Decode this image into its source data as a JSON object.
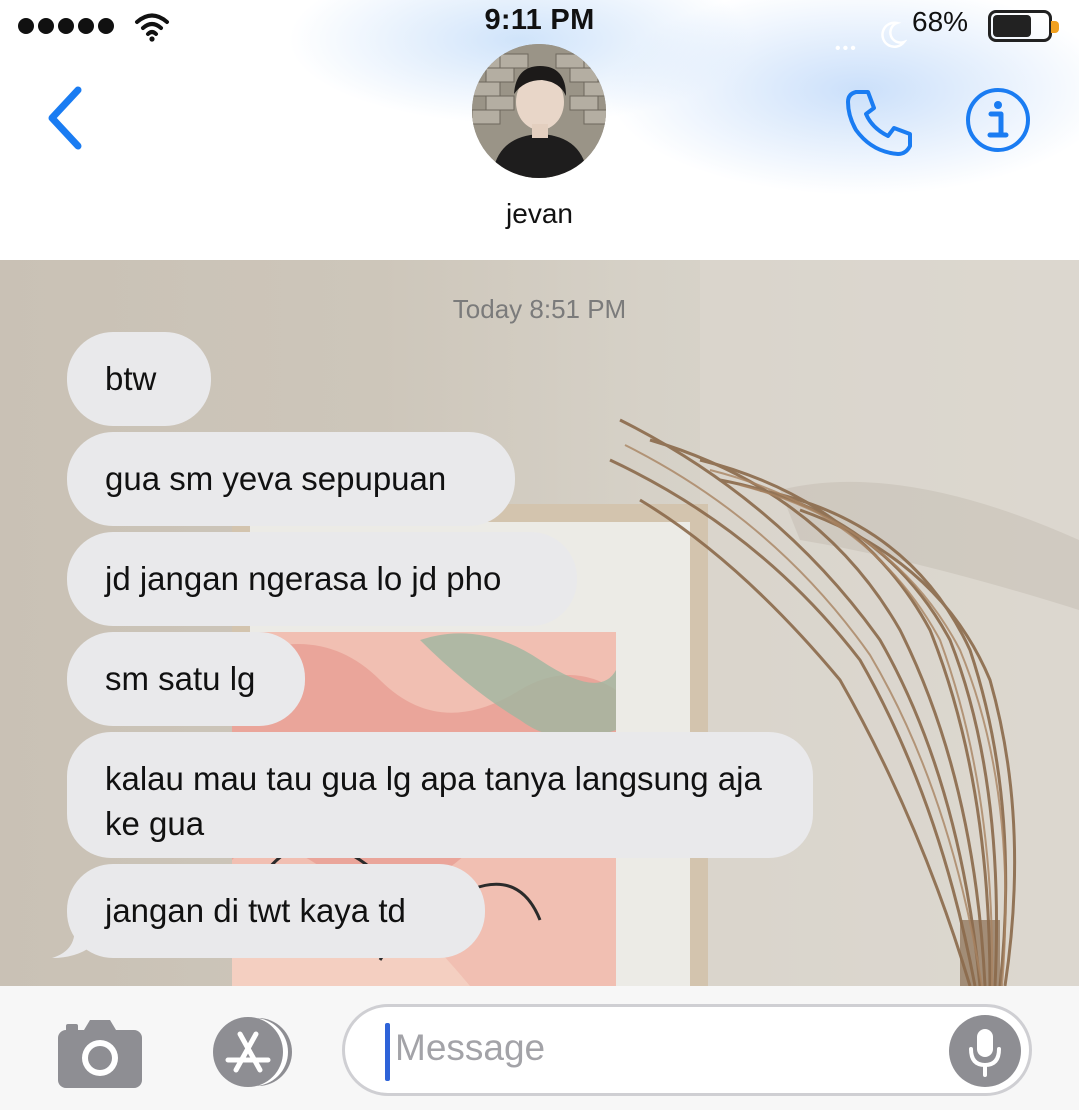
{
  "status_bar": {
    "time": "9:11 PM",
    "battery_percent": "68%",
    "battery_level": 0.68
  },
  "header": {
    "back_icon": "chevron-left-icon",
    "contact_name": "jevan",
    "phone_icon": "phone-icon",
    "info_icon": "info-icon",
    "accent_color": "#1a7cf2"
  },
  "conversation": {
    "timestamp": "Today 8:51 PM",
    "messages": [
      {
        "text": "btw",
        "sender": "contact"
      },
      {
        "text": "gua sm yeva sepupuan",
        "sender": "contact"
      },
      {
        "text": "jd jangan ngerasa lo jd pho",
        "sender": "contact"
      },
      {
        "text": "sm satu lg",
        "sender": "contact"
      },
      {
        "text": "kalau mau tau gua lg apa tanya langsung aja ke gua",
        "sender": "contact"
      },
      {
        "text": "jangan di twt kaya td",
        "sender": "contact"
      }
    ],
    "bubble_color": "#e9e9eb"
  },
  "input_bar": {
    "placeholder": "Message",
    "camera_icon": "camera-icon",
    "apps_icon": "app-store-icon",
    "mic_icon": "microphone-icon"
  }
}
